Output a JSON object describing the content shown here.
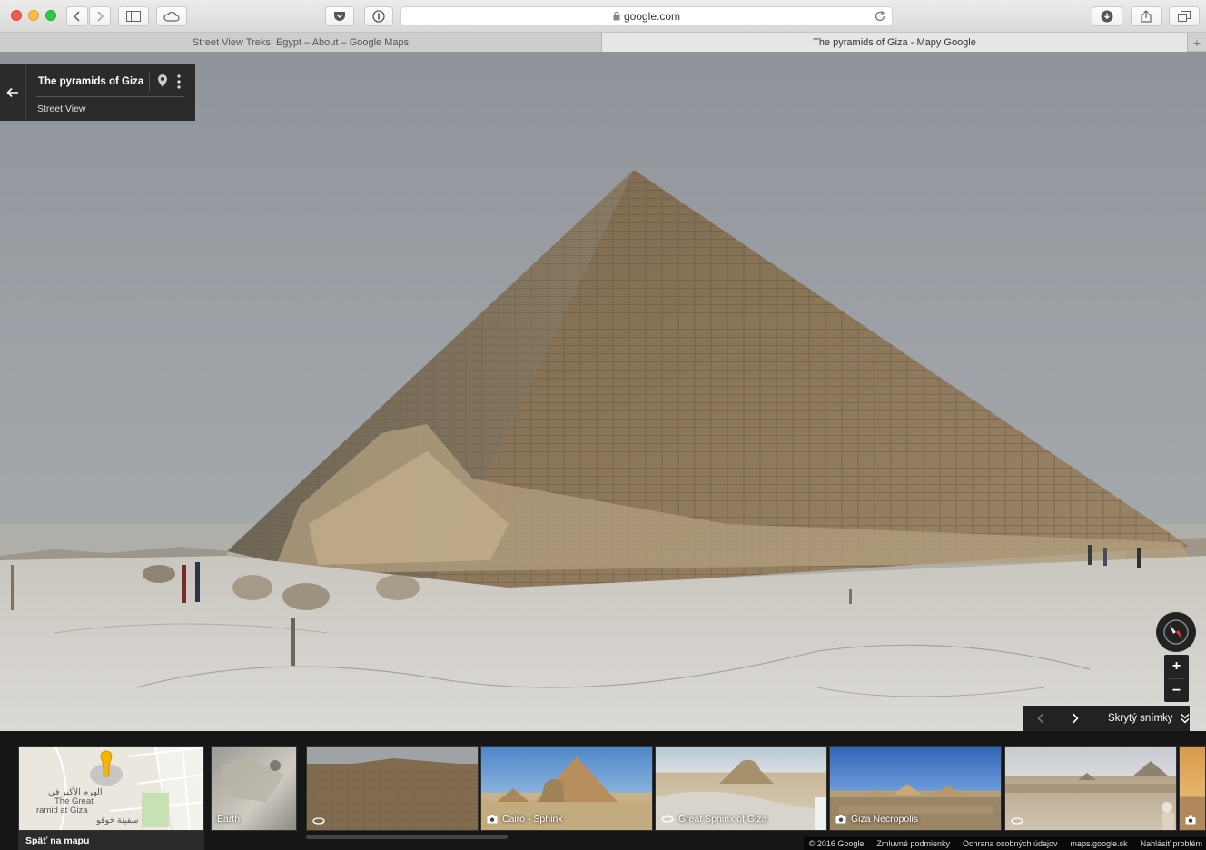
{
  "browser": {
    "url": "google.com",
    "tabs": [
      {
        "label": "Street View Treks: Egypt – About – Google Maps"
      },
      {
        "label": "The pyramids of Giza - Mapy Google"
      }
    ],
    "new_tab": "+"
  },
  "card": {
    "title": "The pyramids of Giza",
    "subtitle": "Street View"
  },
  "controls": {
    "zoom_in": "+",
    "zoom_out": "−",
    "hide_photos": "Skrytý snímky"
  },
  "map_thumb": {
    "labels": [
      "الهرم الأكبر في",
      "The Great",
      "ramid at Giza",
      "سفينة خوفو"
    ],
    "back_label": "Späť na mapu"
  },
  "thumbnails": [
    {
      "label": "Earth",
      "icon": "none"
    },
    {
      "label": "",
      "icon": "360-icon"
    },
    {
      "label": "Cairo - Sphinx",
      "icon": "camera-icon"
    },
    {
      "label": "Great Sphinx of Giza",
      "icon": "360-icon"
    },
    {
      "label": "Giza Necropolis",
      "icon": "camera-icon"
    },
    {
      "label": "",
      "icon": "360-icon"
    },
    {
      "label": "",
      "icon": "camera-icon"
    }
  ],
  "footer": [
    "© 2016 Google",
    "Zmluvné podmienky",
    "Ochrana osobných údajov",
    "maps.google.sk",
    "Nahlásiť problém"
  ],
  "colors": {
    "panel": "#2b2b2b",
    "sky": "#9ea2a7",
    "stone": "#8f7a5e",
    "ground": "#d2d0cc"
  }
}
